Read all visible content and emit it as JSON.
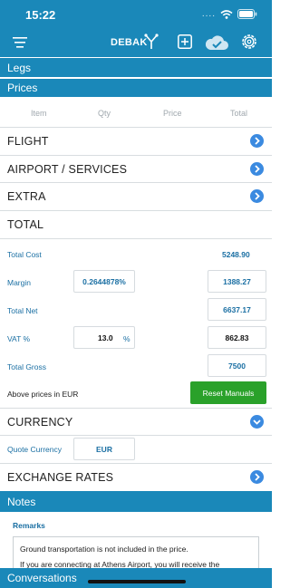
{
  "status": {
    "time": "15:22",
    "dots": "...."
  },
  "toolbar": {
    "route": "DEBAK",
    "icons": [
      "menu-icon",
      "fork-icon",
      "add-icon",
      "cloud-check-icon",
      "gear-icon"
    ]
  },
  "bars": {
    "legs": "Legs",
    "prices": "Prices",
    "notes": "Notes",
    "conversations": "Conversations"
  },
  "table": {
    "columns": [
      "Item",
      "Qty",
      "Price",
      "Total"
    ]
  },
  "sections": {
    "flight": "FLIGHT",
    "airport": "AIRPORT / SERVICES",
    "extra": "EXTRA",
    "total": "TOTAL",
    "currency": "CURRENCY",
    "exchange": "EXCHANGE RATES"
  },
  "totals": {
    "total_cost_label": "Total Cost",
    "total_cost_value": "5248.90",
    "margin_label": "Margin",
    "margin_pct": "0.2644878%",
    "margin_value": "1388.27",
    "total_net_label": "Total Net",
    "total_net_value": "6637.17",
    "vat_label": "VAT %",
    "vat_pct": "13.0",
    "vat_unit": "%",
    "vat_value": "862.83",
    "total_gross_label": "Total Gross",
    "total_gross_value": "7500"
  },
  "prices_note": "Above prices in EUR",
  "reset_label": "Reset Manuals",
  "currency": {
    "quote_label": "Quote Currency",
    "quote_value": "EUR"
  },
  "notes": {
    "remarks_label": "Remarks",
    "line1": "Ground transportation is not included in the price.",
    "line2": "If you are connecting at Athens Airport, you will receive the"
  },
  "colors": {
    "primary": "#1a88b9",
    "accent_green": "#2aa12a",
    "chevron": "#3b8ae0"
  }
}
